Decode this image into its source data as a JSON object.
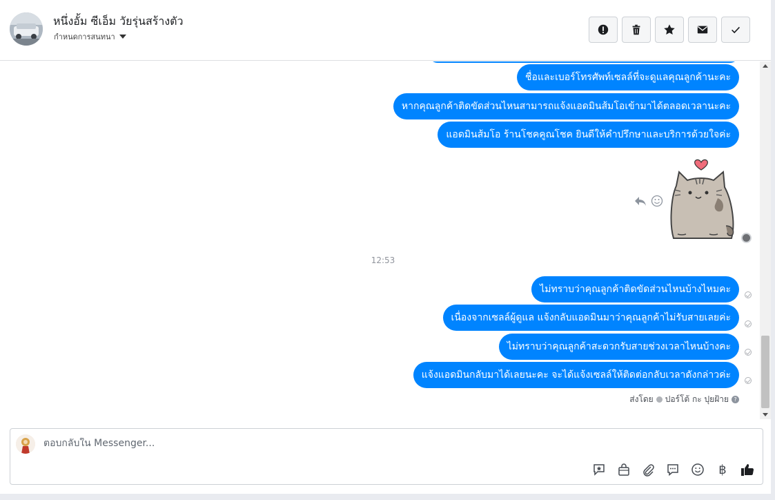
{
  "header": {
    "contact_name": "หนึ่งอั้ม ซีเอ็ม วัยรุ่นสร้างตัว",
    "assign_label": "กำหนดการสนทนา",
    "actions": [
      {
        "icon": "spam-icon",
        "name": "mark-spam-button"
      },
      {
        "icon": "trash-icon",
        "name": "delete-button"
      },
      {
        "icon": "star-icon",
        "name": "star-button"
      },
      {
        "icon": "envelope-icon",
        "name": "mark-unread-button"
      },
      {
        "icon": "check-icon",
        "name": "mark-done-button"
      }
    ]
  },
  "conversation": {
    "messages_before": [
      "ชื่อและเบอร์โทรศัพท์เซลล์ที่จะดูแลคุณลูกค้านะคะ",
      "หากคุณลูกค้าติดขัดส่วนไหนสามารถแจ้งแอดมินส้มโอเข้ามาได้ตลอดเวลานะคะ",
      "แอดมินส้มโอ ร้านโชคคูณโชค ยินดีให้คำปรึกษาและบริการด้วยใจค่ะ"
    ],
    "timestamp": "12:53",
    "messages_after": [
      "ไม่ทราบว่าคุณลูกค้าติดขัดส่วนไหนบ้างไหมคะ",
      "เนื่องจากเซลล์ผู้ดูแล แจ้งกลับแอดมินมาว่าคุณลูกค้าไม่รับสายเลยค่ะ",
      "ไม่ทราบว่าคุณลูกค้าสะดวกรับสายช่วงเวลาไหนบ้างคะ",
      "แจ้งแอดมินกลับมาได้เลยนะคะ จะได้แจ้งเซลล์ให้ติดต่อกลับเวลาดังกล่าวค่ะ"
    ],
    "sent_by_prefix": "ส่งโดย",
    "sent_by_name": "ปอร์โต้ กะ ปุยฝ้าย"
  },
  "composer": {
    "placeholder": "ตอบกลับใน Messenger...",
    "tools": [
      "saved-reply-icon",
      "shop-bag-icon",
      "attachment-icon",
      "chat-bubble-icon",
      "emoji-icon",
      "baht-icon",
      "like-icon"
    ],
    "baht_symbol": "฿"
  },
  "colors": {
    "bubble": "#0084ff",
    "bubble_text": "#ffffff",
    "border": "#ccd0d5"
  }
}
